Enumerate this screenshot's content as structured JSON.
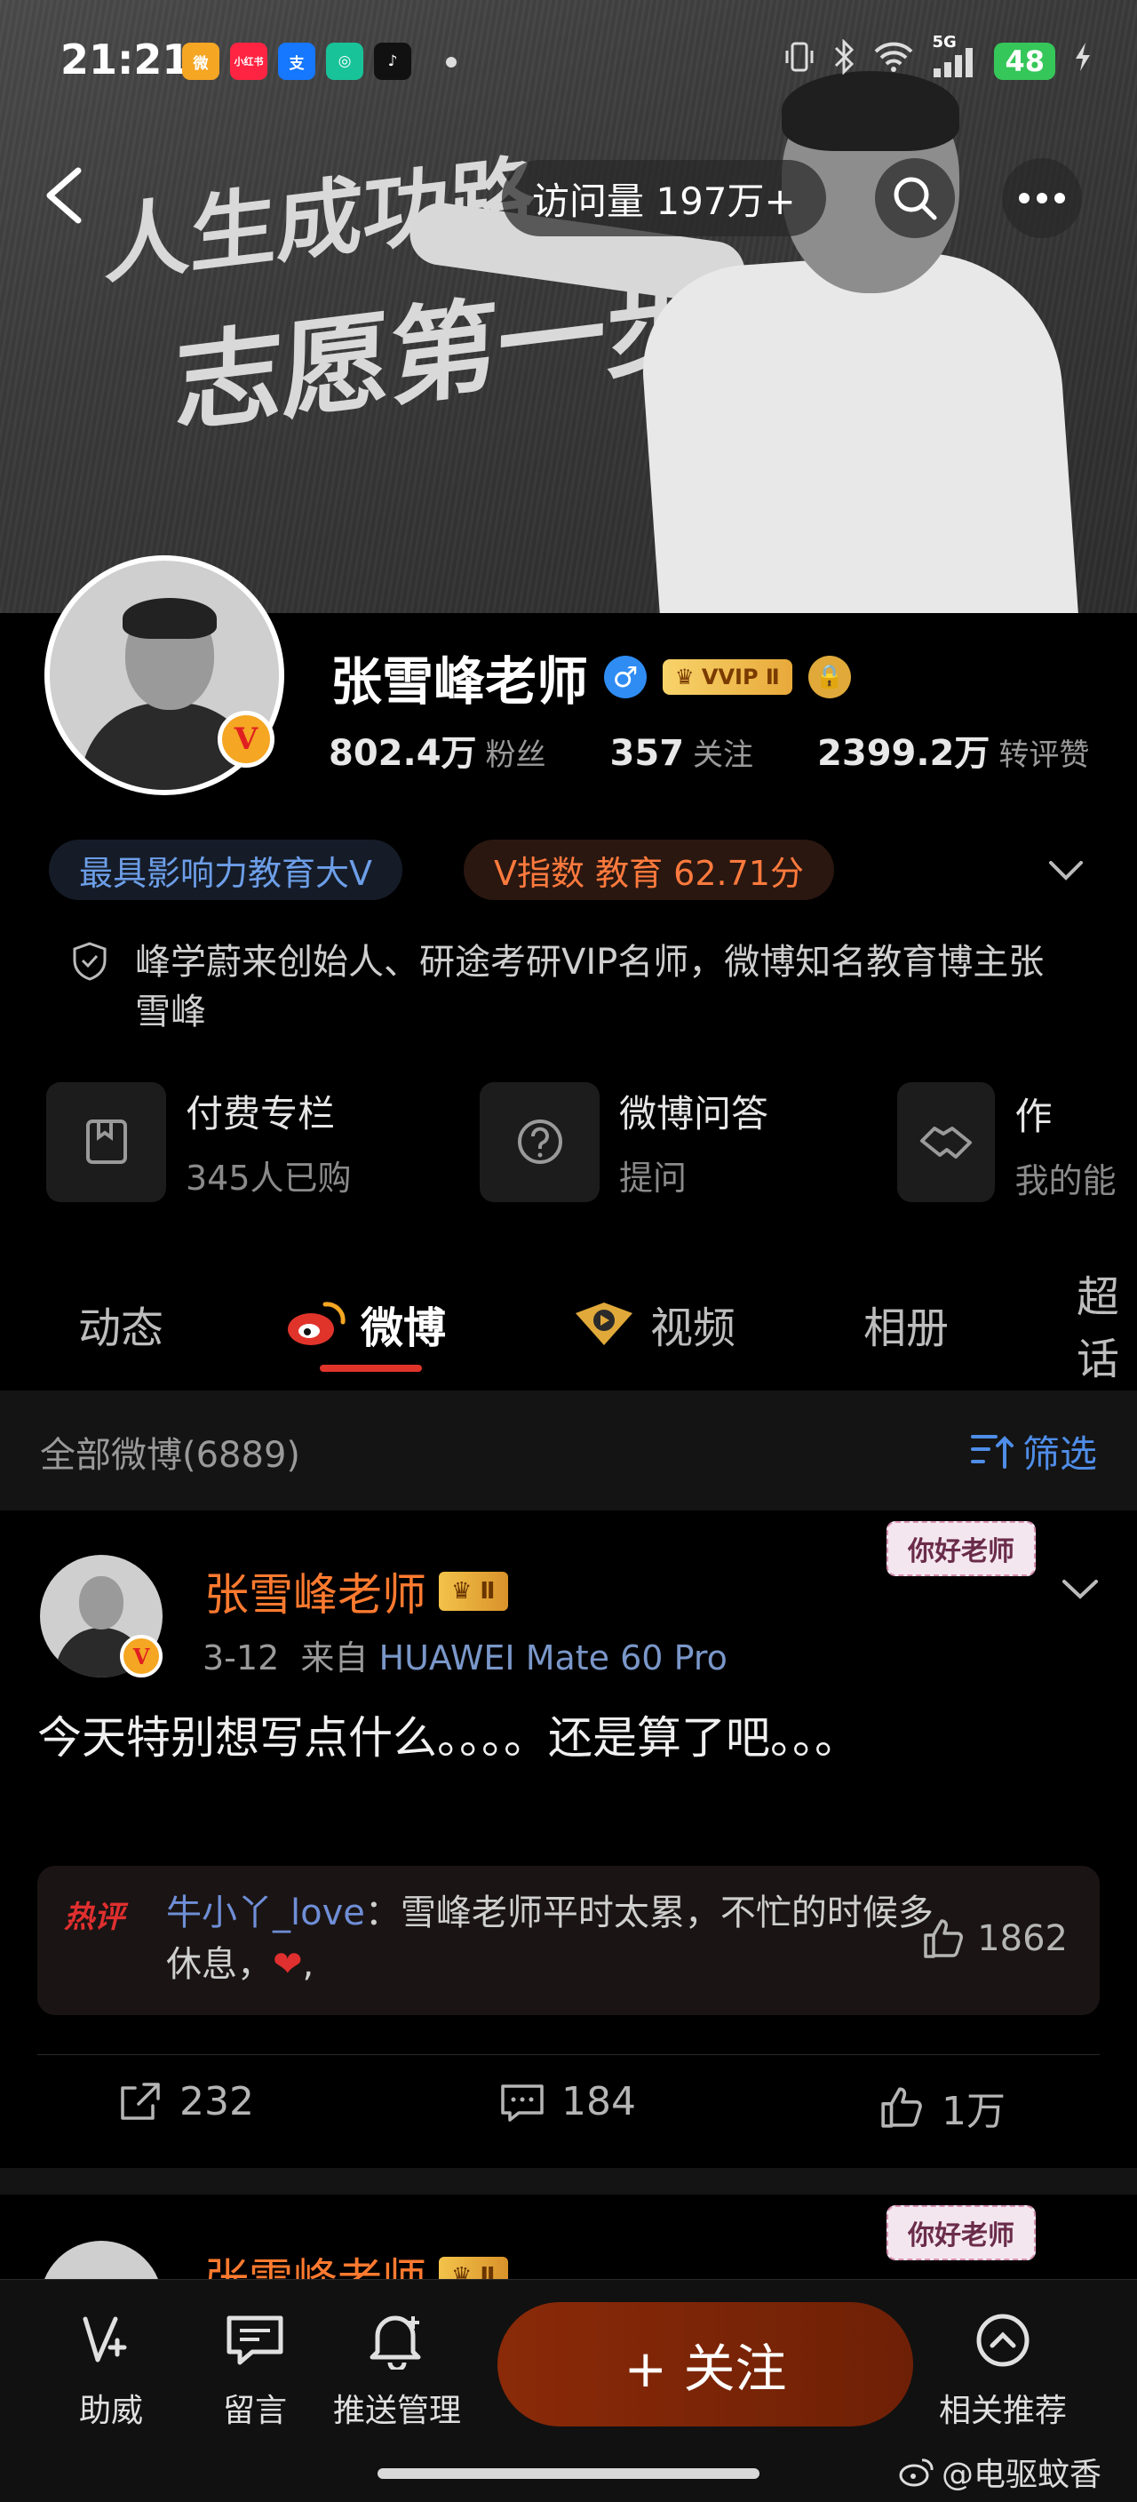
{
  "status_bar": {
    "time": "21:21",
    "apps": [
      {
        "icon": "weibo-app-icon",
        "text": "微",
        "color": "#f5a623"
      },
      {
        "icon": "xiaohongshu-app-icon",
        "text": "小红书",
        "color": "#ff2442"
      },
      {
        "icon": "alipay-app-icon",
        "text": "支",
        "color": "#1677ff"
      },
      {
        "icon": "app-icon",
        "text": "◎",
        "color": "#19c39a"
      },
      {
        "icon": "tiktok-app-icon",
        "text": "♪",
        "color": "#111111"
      }
    ],
    "network": "5G",
    "battery": "48"
  },
  "cover": {
    "line1": "人生成功路",
    "line2": "志愿第一步"
  },
  "header": {
    "visits": "访问量 197万+"
  },
  "profile": {
    "name": "张雪峰老师",
    "vip_label": "VVIP Ⅱ",
    "stats": [
      {
        "value": "802.4万",
        "label": "粉丝"
      },
      {
        "value": "357",
        "label": "关注"
      },
      {
        "value": "2399.2万",
        "label": "转评赞"
      }
    ],
    "tags": {
      "influence": "最具影响力教育大V",
      "v_index": "V指数 教育 62.71分"
    },
    "bio": "峰学蔚来创始人、研途考研VIP名师，微博知名教育博主张雪峰"
  },
  "services": [
    {
      "title": "付费专栏",
      "sub": "345人已购",
      "icon": "bookmark-icon"
    },
    {
      "title": "微博问答",
      "sub": "提问",
      "icon": "question-icon"
    },
    {
      "title": "找我合作",
      "sub": "我的能力",
      "icon": "handshake-icon"
    }
  ],
  "tabs": [
    {
      "label": "动态"
    },
    {
      "label": "微博"
    },
    {
      "label": "视频"
    },
    {
      "label": "相册"
    },
    {
      "label": "超话"
    }
  ],
  "filter": {
    "count": "全部微博(6889)",
    "button": "筛选"
  },
  "post": {
    "author": "张雪峰老师",
    "badge": "Ⅱ",
    "date": "3-12",
    "from": "来自",
    "device": "HUAWEI Mate 60 Pro",
    "sticker": "你好老师",
    "content": "今天特别想写点什么。。。。还是算了吧。。。",
    "hot_comment": {
      "label": "热评",
      "user": "牛小丫_love",
      "text": "：雪峰老师平时太累，不忙的时候多休息，",
      "heart": "❤",
      "likes": "1862"
    },
    "reposts": "232",
    "comments": "184",
    "likes": "1万"
  },
  "post2": {
    "author": "张雪峰老师",
    "badge": "Ⅱ",
    "sticker": "你好老师"
  },
  "bottom_bar": {
    "items": [
      {
        "label": "助威"
      },
      {
        "label": "留言"
      },
      {
        "label": "推送管理"
      },
      {
        "label": "相关推荐"
      }
    ],
    "follow": "+ 关注",
    "watermark": "@电驱蚊香"
  },
  "colors": {
    "accent_orange": "#ff7a2f",
    "tab_underline": "#e0342b",
    "link_blue": "#4f8de8"
  }
}
